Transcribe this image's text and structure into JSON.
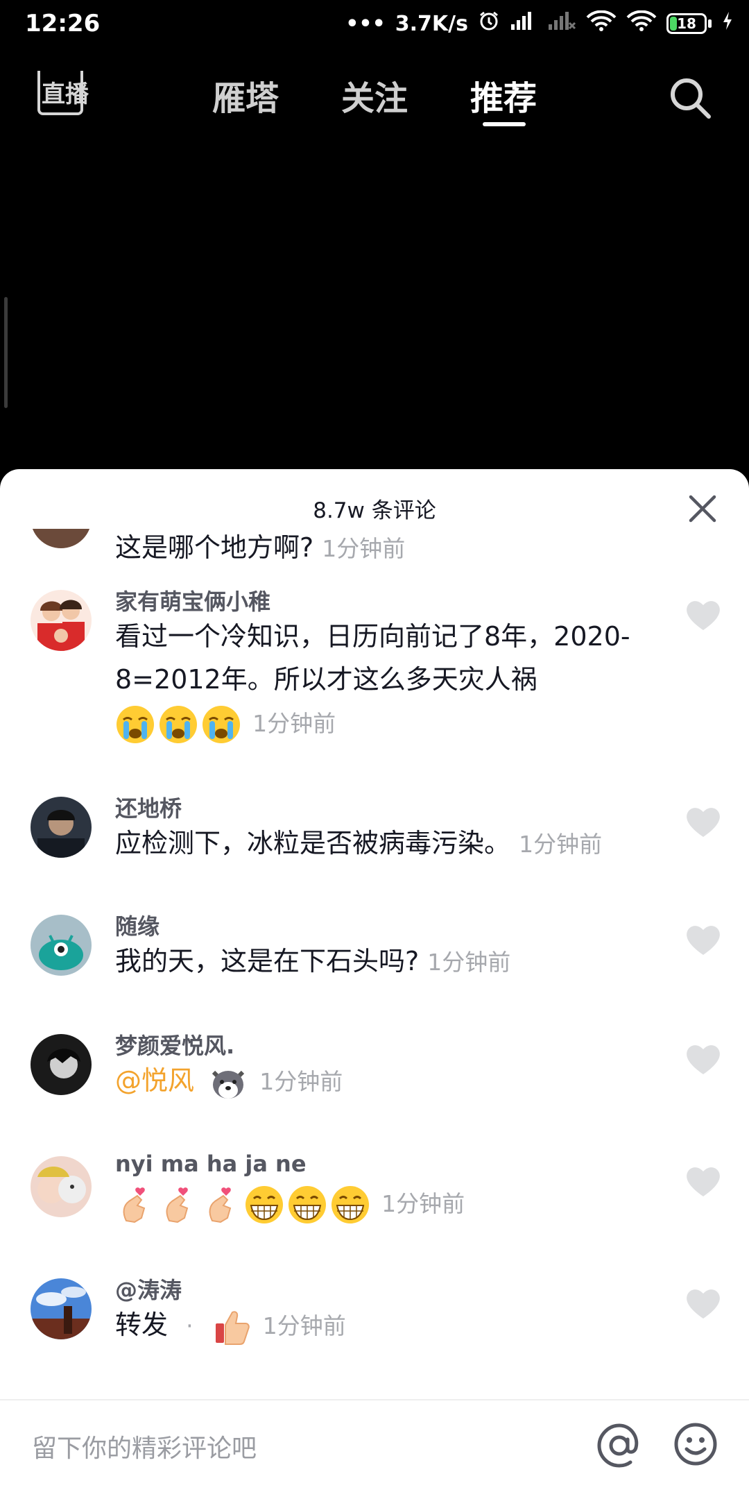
{
  "status_bar": {
    "time": "12:26",
    "network_speed": "3.7K/s",
    "battery_level": "18",
    "icons": [
      "alarm-icon",
      "signal-icon",
      "signal-off-icon",
      "wifi-icon",
      "wifi-icon",
      "battery-icon",
      "charging-icon"
    ]
  },
  "nav": {
    "live_label": "直播",
    "tabs": [
      {
        "label": "雁塔",
        "active": false
      },
      {
        "label": "关注",
        "active": false
      },
      {
        "label": "推荐",
        "active": true
      }
    ],
    "search_icon": "search-icon"
  },
  "comments_panel": {
    "title": "8.7w 条评论",
    "close_icon": "close-icon",
    "comments": [
      {
        "author": "",
        "text": "这是哪个地方啊?",
        "time": "1分钟前",
        "emojis": []
      },
      {
        "author": "家有萌宝俩小稚",
        "text": "看过一个冷知识，日历向前记了8年，2020-8=2012年。所以才这么多天灾人祸",
        "time": "1分钟前",
        "emojis": [
          "crying-emoji",
          "crying-emoji",
          "crying-emoji"
        ]
      },
      {
        "author": "还地桥",
        "text": "应检测下，冰粒是否被病毒污染。",
        "time": "1分钟前",
        "emojis": []
      },
      {
        "author": "随缘",
        "text": "我的天，这是在下石头吗?",
        "time": "1分钟前",
        "emojis": []
      },
      {
        "author": "梦颜爱悦风.",
        "mention": "@悦风",
        "text": "",
        "time": "1分钟前",
        "emojis": [
          "husky-emoji"
        ]
      },
      {
        "author": "nyi ma ha ja ne",
        "text": "",
        "time": "1分钟前",
        "emojis": [
          "finger-heart-emoji",
          "finger-heart-emoji",
          "finger-heart-emoji",
          "grin-emoji",
          "grin-emoji",
          "grin-emoji"
        ]
      },
      {
        "author": "@涛涛",
        "text": "转发",
        "separator": "·",
        "time": "1分钟前",
        "emojis": [
          "thumbs-up-emoji"
        ]
      }
    ]
  },
  "input": {
    "placeholder": "留下你的精彩评论吧",
    "at_label": "@",
    "emoji_icon": "smiley-icon"
  },
  "colors": {
    "accent_mention": "#f3a32d",
    "text_primary": "#161823",
    "text_secondary": "#a6a8ad",
    "battery_fill": "#4CD964"
  }
}
